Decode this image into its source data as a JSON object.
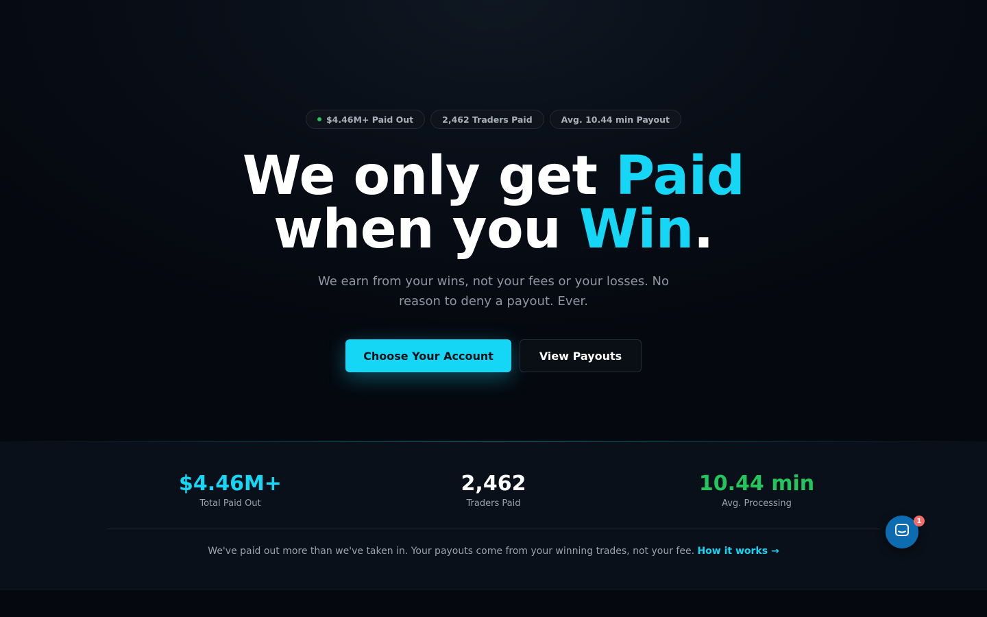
{
  "hero": {
    "pills": [
      {
        "label": "$4.46M+ Paid Out",
        "dot_color": "#22c55e"
      },
      {
        "label": "2,462 Traders Paid"
      },
      {
        "label": "Avg. 10.44 min Payout"
      }
    ],
    "headline": {
      "line1_prefix": "We only get ",
      "line1_accent": "Paid",
      "line2_prefix": "when you ",
      "line2_accent": "Win",
      "line2_suffix": "."
    },
    "subheadline": "We earn from your wins, not your fees or your losses. No reason to deny a payout. Ever.",
    "primary_button": "Choose Your Account",
    "secondary_button": "View Payouts"
  },
  "stats": {
    "items": [
      {
        "value": "$4.46M+",
        "label": "Total Paid Out",
        "color": "#16d6f5"
      },
      {
        "value": "2,462",
        "label": "Traders Paid",
        "color": "#ffffff"
      },
      {
        "value": "10.44 min",
        "label": "Avg. Processing",
        "color": "#22c55e"
      }
    ],
    "note_text": "We've paid out more than we've taken in. Your payouts come from your winning trades, not your fee. ",
    "note_link": "How it works →"
  },
  "chat_widget": {
    "icon": "chat-icon",
    "badge_count": "1"
  },
  "colors": {
    "accent": "#16d6f5",
    "success": "#22c55e",
    "background": "#05080f"
  }
}
